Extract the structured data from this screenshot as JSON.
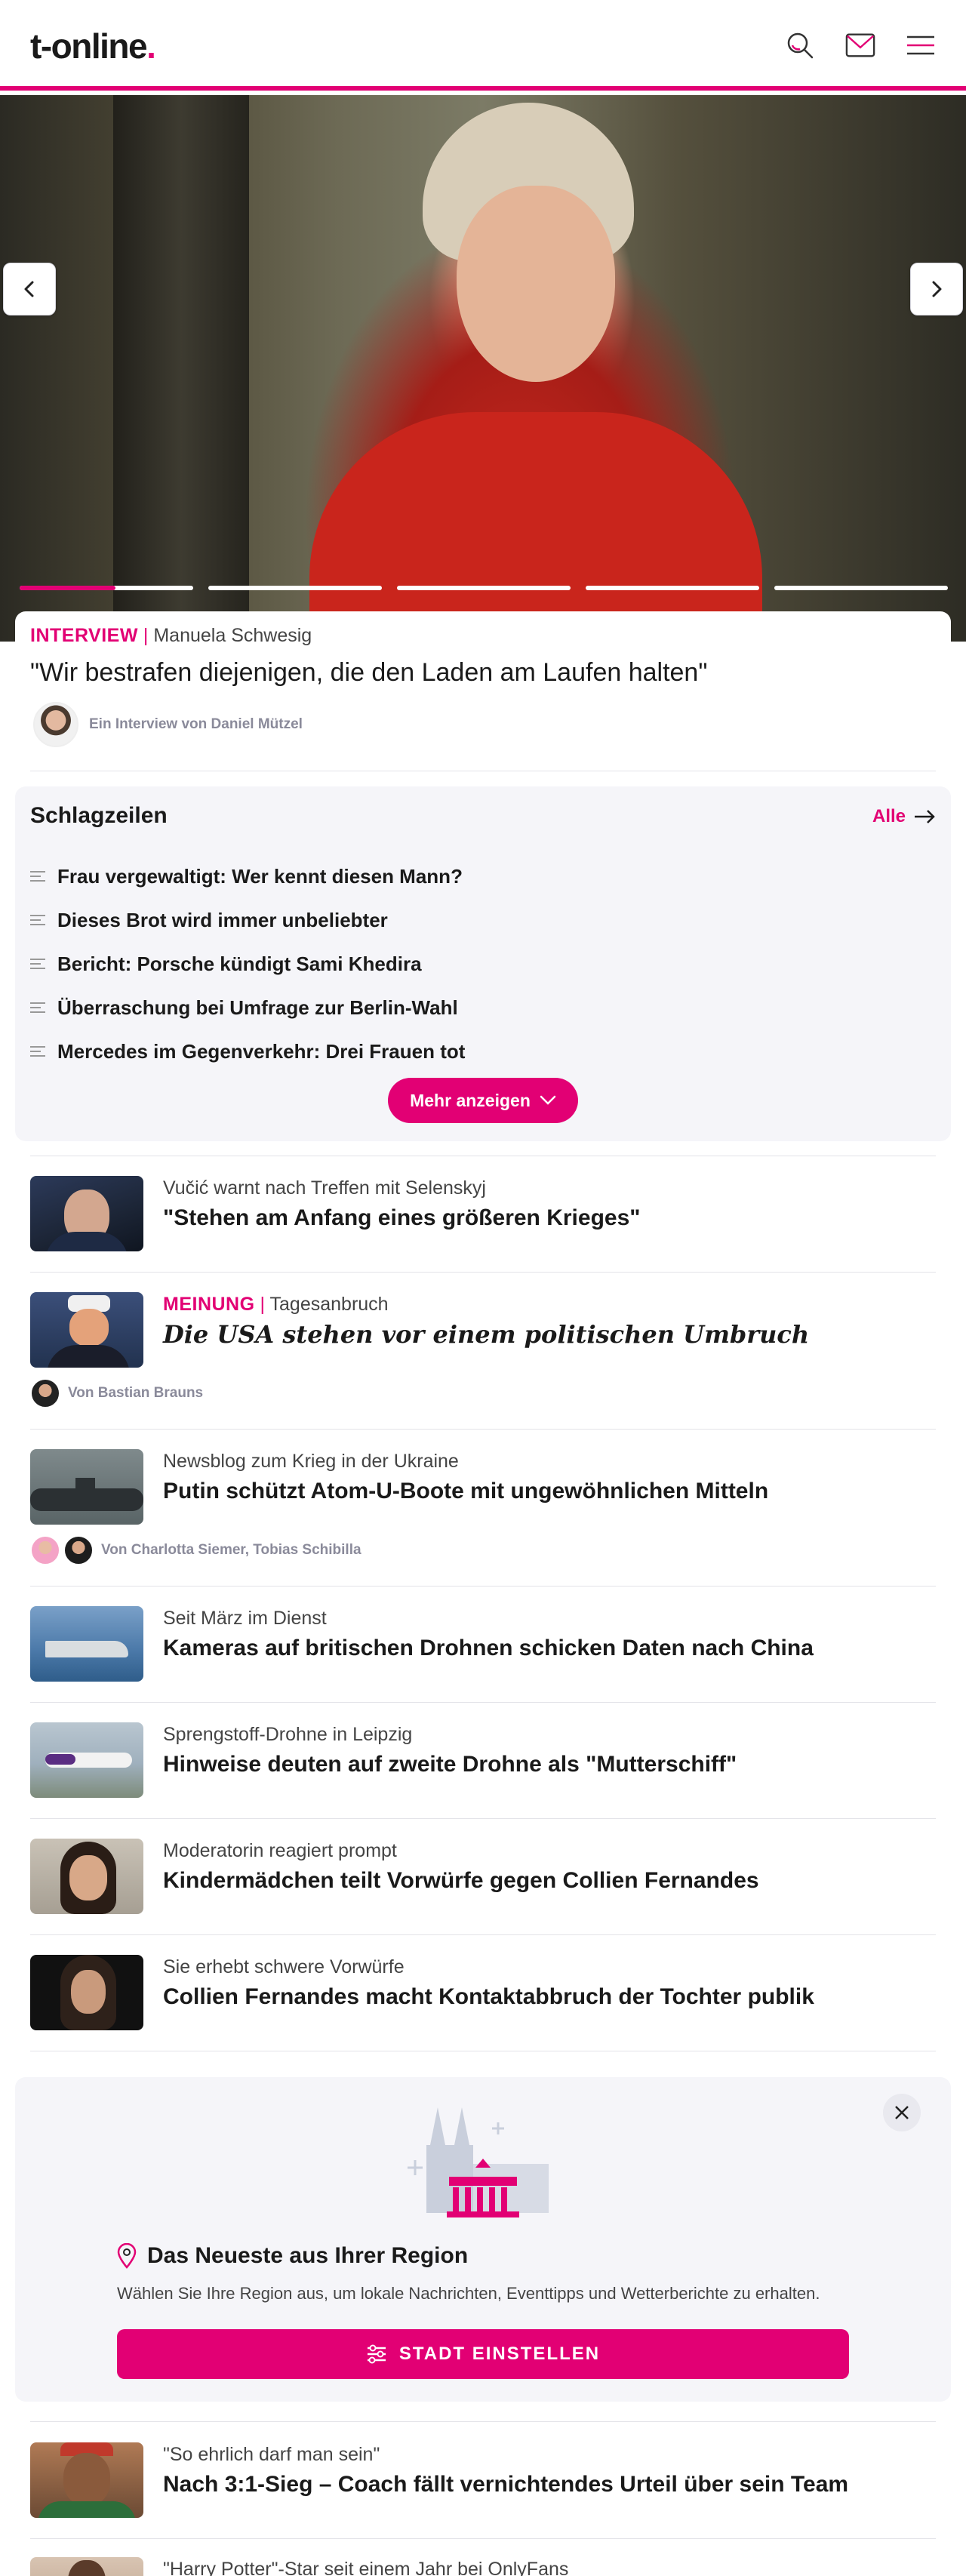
{
  "header": {
    "logo_text": "t-online",
    "logo_dot": ".",
    "icons": [
      "search-icon",
      "mail-icon",
      "menu-icon"
    ],
    "accent": "#e20074"
  },
  "hero": {
    "slides_count": 5,
    "active_slide_progress": 0.55,
    "prev_icon": "chevron-left-icon",
    "next_icon": "chevron-right-icon"
  },
  "top_article": {
    "tag": "INTERVIEW",
    "separator": "|",
    "subject": "Manuela Schwesig",
    "headline": "\"Wir bestrafen diejenigen, die den Laden am Laufen halten\"",
    "author": "Ein Interview von Daniel Mützel"
  },
  "headlines": {
    "title": "Schlagzeilen",
    "all_label": "Alle",
    "items": [
      "Frau vergewaltigt: Wer kennt diesen Mann?",
      "Dieses Brot wird immer unbeliebter",
      "Bericht: Porsche kündigt Sami Khedira",
      "Überraschung bei Umfrage zur Berlin-Wahl",
      "Mercedes im Gegenverkehr: Drei Frauen tot"
    ],
    "more_label": "Mehr anzeigen"
  },
  "teasers": [
    {
      "kicker": "Vučić warnt nach Treffen mit Selenskyj",
      "title": "\"Stehen am Anfang eines größeren Krieges\""
    },
    {
      "tag": "MEINUNG",
      "separator": "|",
      "kicker": "Tagesanbruch",
      "title": "Die USA stehen vor einem politischen Umbruch",
      "author": "Von Bastian Brauns"
    },
    {
      "kicker": "Newsblog zum Krieg in der Ukraine",
      "title": "Putin schützt Atom-U-Boote mit ungewöhnlichen Mitteln",
      "author": "Von Charlotta Siemer, Tobias Schibilla"
    },
    {
      "kicker": "Seit März im Dienst",
      "title": "Kameras auf britischen Drohnen schicken Daten nach China"
    },
    {
      "kicker": "Sprengstoff-Drohne in Leipzig",
      "title": "Hinweise deuten auf zweite Drohne als \"Mutterschiff\""
    },
    {
      "kicker": "Moderatorin reagiert prompt",
      "title": "Kindermädchen teilt Vorwürfe gegen Collien Fernandes"
    },
    {
      "kicker": "Sie erhebt schwere Vorwürfe",
      "title": "Collien Fernandes macht Kontaktabbruch der Tochter publik"
    }
  ],
  "region": {
    "title": "Das Neueste aus Ihrer Region",
    "description": "Wählen Sie Ihre Region aus, um lokale Nachrichten, Eventtipps und Wetterberichte zu erhalten.",
    "button_label": "STADT EINSTELLEN"
  },
  "more_teasers": [
    {
      "kicker": "\"So ehrlich darf man sein\"",
      "title": "Nach 3:1-Sieg – Coach fällt vernichtendes Urteil über sein Team"
    },
    {
      "kicker": "\"Harry Potter\"-Star seit einem Jahr bei OnlyFans"
    }
  ]
}
